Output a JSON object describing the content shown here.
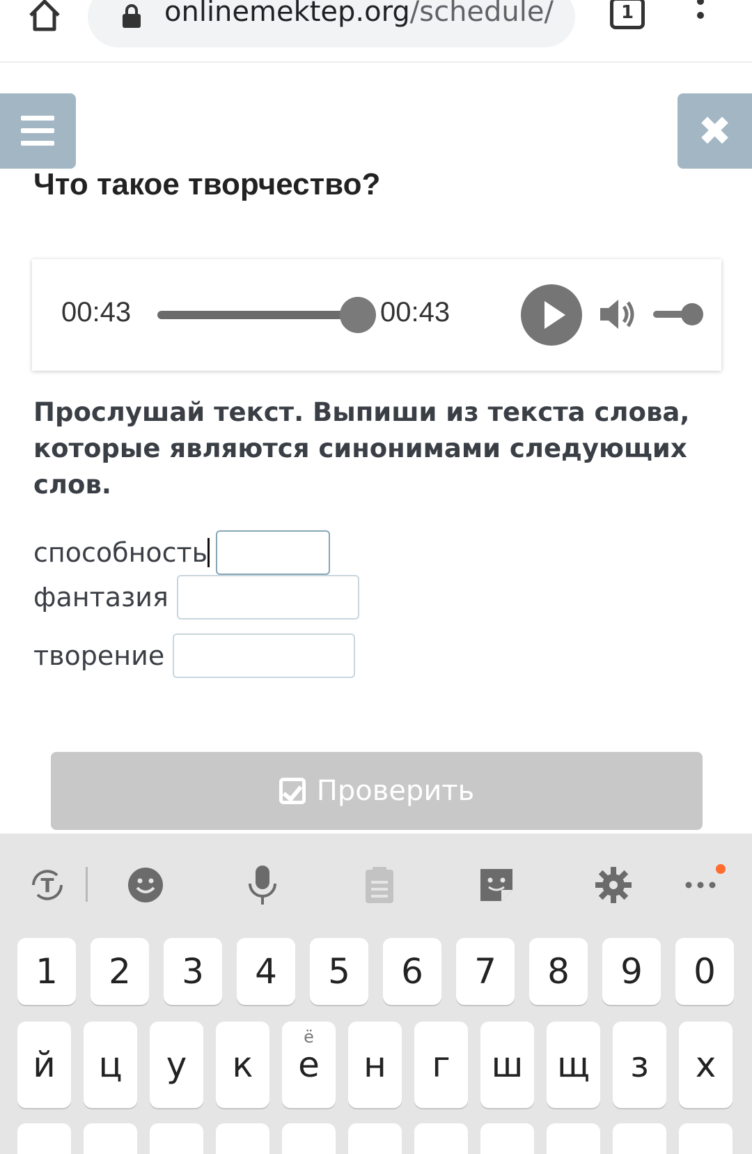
{
  "browser": {
    "url_host": "onlinemektep.org",
    "url_path": "/schedule/",
    "tab_count": "1"
  },
  "page": {
    "title": "Что такое творчество?",
    "close_symbol": "✖"
  },
  "player": {
    "current_time": "00:43",
    "duration": "00:43",
    "progress_fraction": 1.0,
    "volume_fraction": 0.8
  },
  "task": {
    "instruction": "Прослушай текст. Выпиши из текста слова, которые являются синонимами следующих слов.",
    "fields": [
      {
        "label": "способность",
        "value": ""
      },
      {
        "label": "фантазия",
        "value": ""
      },
      {
        "label": "творение",
        "value": ""
      }
    ],
    "check_label": "Проверить"
  },
  "keyboard": {
    "toolbar_icons": [
      "text-style-icon",
      "emoji-icon",
      "microphone-icon",
      "clipboard-icon",
      "sticker-icon",
      "settings-icon",
      "more-icon"
    ],
    "number_row": [
      "1",
      "2",
      "3",
      "4",
      "5",
      "6",
      "7",
      "8",
      "9",
      "0"
    ],
    "letter_row": [
      "й",
      "ц",
      "у",
      "к",
      "е",
      "н",
      "г",
      "ш",
      "щ",
      "з",
      "х"
    ],
    "e_alt": "ё"
  },
  "colors": {
    "nav_button": "#a2b6c3",
    "check_button_disabled": "#c8c8c8",
    "keyboard_bg": "#e5e5e5",
    "notification_dot": "#ff6d2e"
  }
}
